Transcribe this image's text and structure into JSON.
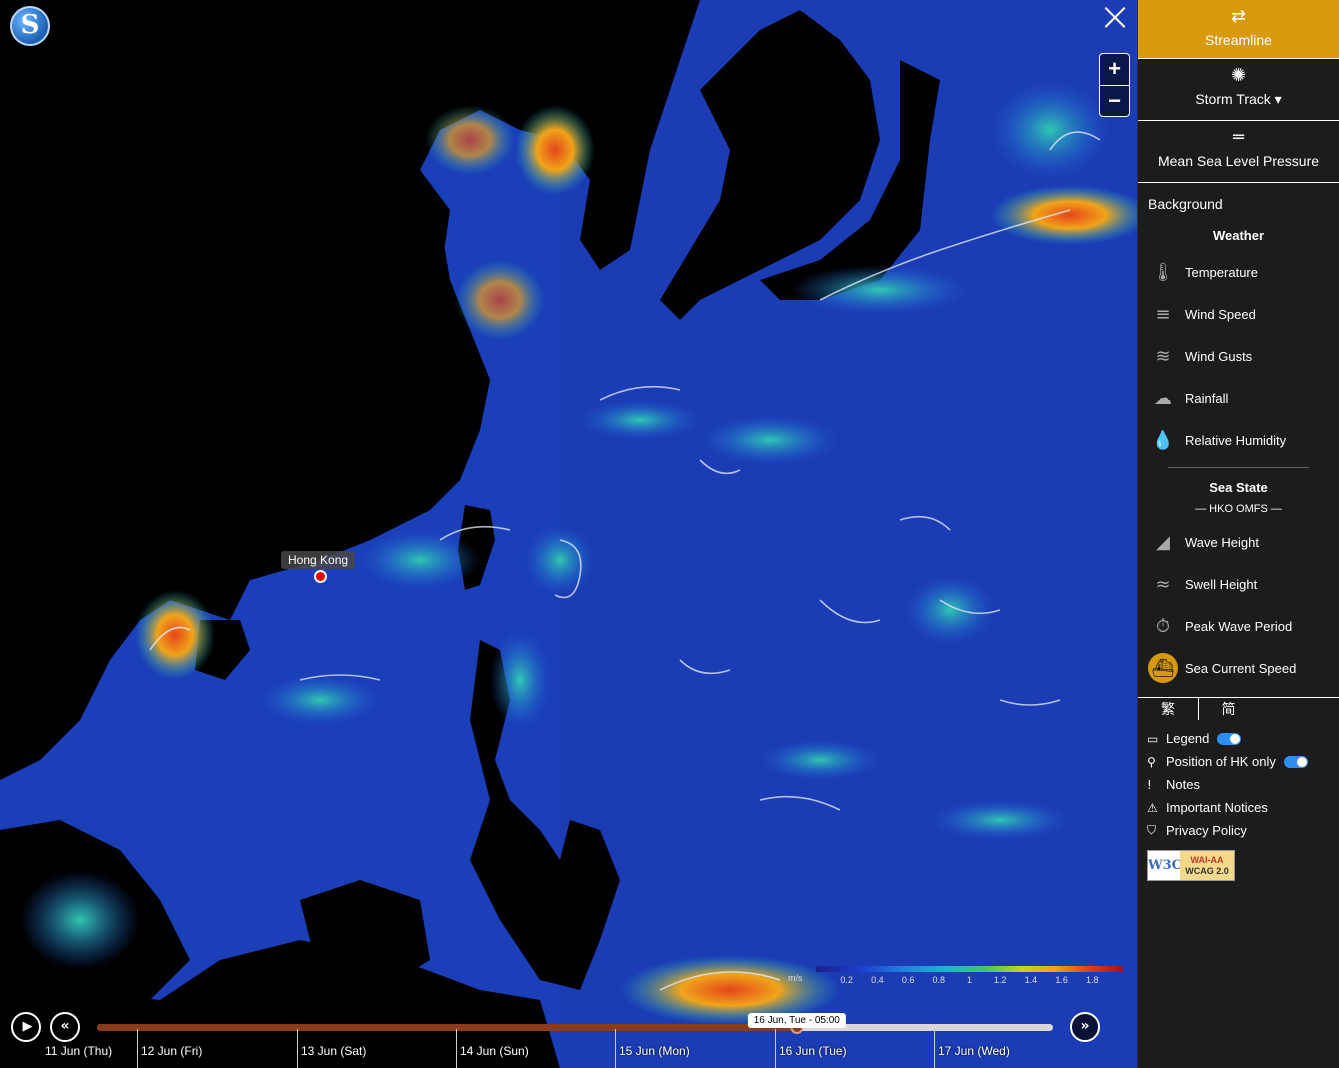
{
  "map": {
    "logo_letter": "S",
    "close_label": "×",
    "zoom_in": "+",
    "zoom_out": "−",
    "location_label": "Hong Kong"
  },
  "legend": {
    "unit": "m/s",
    "ticks": [
      "0.2",
      "0.4",
      "0.6",
      "0.8",
      "1",
      "1.2",
      "1.4",
      "1.6",
      "1.8"
    ],
    "range": [
      0,
      2.0
    ],
    "colors": [
      "#1b1f8a",
      "#1e3fd0",
      "#1f7fe0",
      "#15b8c8",
      "#3cc86a",
      "#c8d21e",
      "#f0a41a",
      "#e5461a",
      "#a0101a"
    ]
  },
  "timeline": {
    "play_icon": "▶",
    "rewind_icon": "«",
    "forward_icon": "»",
    "current_time": "16 Jun, Tue - 05:00",
    "progress": 0.732,
    "days": [
      "11 Jun (Thu)",
      "12 Jun (Fri)",
      "13 Jun (Sat)",
      "14 Jun (Sun)",
      "15 Jun (Mon)",
      "16 Jun (Tue)",
      "17 Jun (Wed)"
    ]
  },
  "panel": {
    "overlays": [
      {
        "icon": "⇄",
        "label": "Streamline",
        "active": true
      },
      {
        "icon": "✺",
        "label": "Storm Track ▾",
        "active": false
      },
      {
        "icon": "═",
        "label": "Mean Sea Level Pressure",
        "active": false
      }
    ],
    "background_title": "Background",
    "weather_title": "Weather",
    "weather_items": [
      {
        "icon": "🌡",
        "label": "Temperature"
      },
      {
        "icon": "≡",
        "label": "Wind Speed"
      },
      {
        "icon": "≋",
        "label": "Wind Gusts"
      },
      {
        "icon": "☁",
        "label": "Rainfall"
      },
      {
        "icon": "💧",
        "label": "Relative Humidity"
      }
    ],
    "sea_title": "Sea State",
    "sea_subtitle": "— HKO OMFS —",
    "sea_items": [
      {
        "icon": "◢",
        "label": "Wave Height"
      },
      {
        "icon": "≈",
        "label": "Swell Height"
      },
      {
        "icon": "⏱",
        "label": "Peak Wave Period"
      },
      {
        "icon": "⛴",
        "label": "Sea Current Speed",
        "selected": true
      }
    ],
    "lang": [
      "繁",
      "简"
    ],
    "options": [
      {
        "icon": "▭",
        "label": "Legend",
        "toggle": true
      },
      {
        "icon": "⚲",
        "label": "Position of HK only",
        "toggle": true
      },
      {
        "icon": "!",
        "label": "Notes"
      },
      {
        "icon": "⚠",
        "label": "Important Notices"
      },
      {
        "icon": "⛉",
        "label": "Privacy Policy"
      }
    ],
    "wcag": {
      "w3c": "W3C",
      "line1": "WAI-AA",
      "line2": "WCAG 2.0"
    }
  }
}
